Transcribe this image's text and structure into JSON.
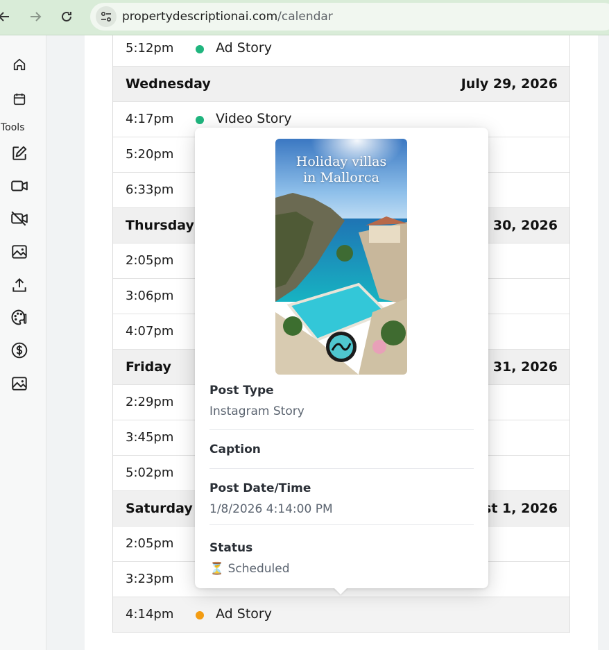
{
  "browser": {
    "url_domain": "propertydescriptionai.com",
    "url_path": "/calendar"
  },
  "sidebar": {
    "tools_label": "Tools",
    "icons": [
      "home-icon",
      "calendar-icon",
      "edit-icon",
      "video-icon",
      "video-off-icon",
      "image-icon",
      "upload-icon",
      "palette-icon",
      "dollar-icon",
      "gallery-icon"
    ]
  },
  "calendar": {
    "top_entry": {
      "time": "5:12pm",
      "event": "Ad Story",
      "dot_color": "#1fb57e"
    },
    "days": [
      {
        "day": "Wednesday",
        "date": "July 29, 2026",
        "entries": [
          {
            "time": "4:17pm",
            "event": "Video Story",
            "dot_color": "#1fb57e"
          },
          {
            "time": "5:20pm"
          },
          {
            "time": "6:33pm"
          }
        ]
      },
      {
        "day": "Thursday",
        "date": "July 30, 2026",
        "entries": [
          {
            "time": "2:05pm"
          },
          {
            "time": "3:06pm"
          },
          {
            "time": "4:07pm"
          }
        ]
      },
      {
        "day": "Friday",
        "date": "July 31, 2026",
        "entries": [
          {
            "time": "2:29pm"
          },
          {
            "time": "3:45pm"
          },
          {
            "time": "5:02pm"
          }
        ]
      },
      {
        "day": "Saturday",
        "date": "August 1, 2026",
        "entries": [
          {
            "time": "2:05pm"
          },
          {
            "time": "3:23pm"
          },
          {
            "time": "4:14pm",
            "event": "Ad Story",
            "dot_color": "#f39c12"
          }
        ]
      }
    ]
  },
  "popover": {
    "thumb_title_line1": "Holiday villas",
    "thumb_title_line2": "in Mallorca",
    "post_type_label": "Post Type",
    "post_type_value": "Instagram Story",
    "caption_label": "Caption",
    "post_date_label": "Post Date/Time",
    "post_date_value": "1/8/2026 4:14:00 PM",
    "status_label": "Status",
    "status_icon": "⏳",
    "status_value": "Scheduled",
    "status_color": "#c47c10"
  }
}
